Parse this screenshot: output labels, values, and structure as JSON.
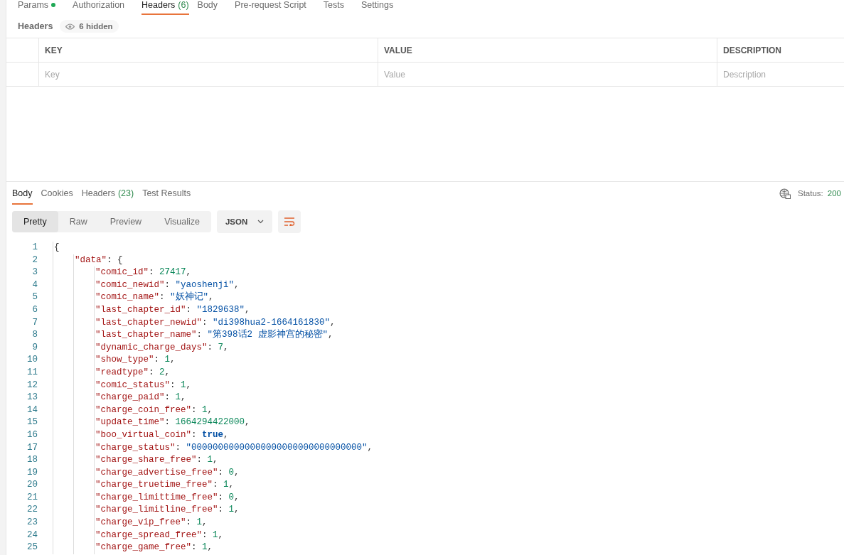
{
  "request_tabs": [
    {
      "label": "Params",
      "dot": true,
      "selected": false
    },
    {
      "label": "Authorization",
      "dot": false,
      "selected": false
    },
    {
      "label": "Headers",
      "count": "(6)",
      "dot": false,
      "selected": true
    },
    {
      "label": "Body",
      "dot": false,
      "selected": false
    },
    {
      "label": "Pre-request Script",
      "dot": false,
      "selected": false
    },
    {
      "label": "Tests",
      "dot": false,
      "selected": false
    },
    {
      "label": "Settings",
      "dot": false,
      "selected": false
    }
  ],
  "headers_bar": {
    "title": "Headers",
    "hidden": "6 hidden"
  },
  "table": {
    "columns": [
      "KEY",
      "VALUE",
      "DESCRIPTION"
    ],
    "placeholders": [
      "Key",
      "Value",
      "Description"
    ]
  },
  "response_tabs": [
    {
      "label": "Body",
      "selected": true
    },
    {
      "label": "Cookies",
      "selected": false
    },
    {
      "label": "Headers",
      "count": "(23)",
      "selected": false
    },
    {
      "label": "Test Results",
      "selected": false
    }
  ],
  "status": {
    "label": "Status:",
    "value": "200"
  },
  "view_modes": [
    {
      "label": "Pretty",
      "selected": true
    },
    {
      "label": "Raw",
      "selected": false
    },
    {
      "label": "Preview",
      "selected": false
    },
    {
      "label": "Visualize",
      "selected": false
    }
  ],
  "format": "JSON",
  "code": [
    {
      "number": "1",
      "tokens": [
        {
          "kind": "punct",
          "text": "{"
        }
      ],
      "children": [
        {
          "number": "2",
          "tokens": [
            {
              "kind": "key",
              "text": "\"data\""
            },
            {
              "kind": "punct",
              "text": ": {"
            }
          ],
          "children": [
            {
              "number": "3",
              "tokens": [
                {
                  "kind": "key",
                  "text": "\"comic_id\""
                },
                {
                  "kind": "punct",
                  "text": ": "
                },
                {
                  "kind": "number",
                  "text": "27417"
                },
                {
                  "kind": "punct",
                  "text": ","
                }
              ]
            },
            {
              "number": "4",
              "tokens": [
                {
                  "kind": "key",
                  "text": "\"comic_newid\""
                },
                {
                  "kind": "punct",
                  "text": ": "
                },
                {
                  "kind": "string",
                  "text": "\"yaoshenji\""
                },
                {
                  "kind": "punct",
                  "text": ","
                }
              ]
            },
            {
              "number": "5",
              "tokens": [
                {
                  "kind": "key",
                  "text": "\"comic_name\""
                },
                {
                  "kind": "punct",
                  "text": ": "
                },
                {
                  "kind": "string",
                  "text": "\"妖神记\""
                },
                {
                  "kind": "punct",
                  "text": ","
                }
              ]
            },
            {
              "number": "6",
              "tokens": [
                {
                  "kind": "key",
                  "text": "\"last_chapter_id\""
                },
                {
                  "kind": "punct",
                  "text": ": "
                },
                {
                  "kind": "string",
                  "text": "\"1829638\""
                },
                {
                  "kind": "punct",
                  "text": ","
                }
              ]
            },
            {
              "number": "7",
              "tokens": [
                {
                  "kind": "key",
                  "text": "\"last_chapter_newid\""
                },
                {
                  "kind": "punct",
                  "text": ": "
                },
                {
                  "kind": "string",
                  "text": "\"di398hua2-1664161830\""
                },
                {
                  "kind": "punct",
                  "text": ","
                }
              ]
            },
            {
              "number": "8",
              "tokens": [
                {
                  "kind": "key",
                  "text": "\"last_chapter_name\""
                },
                {
                  "kind": "punct",
                  "text": ": "
                },
                {
                  "kind": "string",
                  "text": "\"第398话2 虚影神宫的秘密\""
                },
                {
                  "kind": "punct",
                  "text": ","
                }
              ]
            },
            {
              "number": "9",
              "tokens": [
                {
                  "kind": "key",
                  "text": "\"dynamic_charge_days\""
                },
                {
                  "kind": "punct",
                  "text": ": "
                },
                {
                  "kind": "number",
                  "text": "7"
                },
                {
                  "kind": "punct",
                  "text": ","
                }
              ]
            },
            {
              "number": "10",
              "tokens": [
                {
                  "kind": "key",
                  "text": "\"show_type\""
                },
                {
                  "kind": "punct",
                  "text": ": "
                },
                {
                  "kind": "number",
                  "text": "1"
                },
                {
                  "kind": "punct",
                  "text": ","
                }
              ]
            },
            {
              "number": "11",
              "tokens": [
                {
                  "kind": "key",
                  "text": "\"readtype\""
                },
                {
                  "kind": "punct",
                  "text": ": "
                },
                {
                  "kind": "number",
                  "text": "2"
                },
                {
                  "kind": "punct",
                  "text": ","
                }
              ]
            },
            {
              "number": "12",
              "tokens": [
                {
                  "kind": "key",
                  "text": "\"comic_status\""
                },
                {
                  "kind": "punct",
                  "text": ": "
                },
                {
                  "kind": "number",
                  "text": "1"
                },
                {
                  "kind": "punct",
                  "text": ","
                }
              ]
            },
            {
              "number": "13",
              "tokens": [
                {
                  "kind": "key",
                  "text": "\"charge_paid\""
                },
                {
                  "kind": "punct",
                  "text": ": "
                },
                {
                  "kind": "number",
                  "text": "1"
                },
                {
                  "kind": "punct",
                  "text": ","
                }
              ]
            },
            {
              "number": "14",
              "tokens": [
                {
                  "kind": "key",
                  "text": "\"charge_coin_free\""
                },
                {
                  "kind": "punct",
                  "text": ": "
                },
                {
                  "kind": "number",
                  "text": "1"
                },
                {
                  "kind": "punct",
                  "text": ","
                }
              ]
            },
            {
              "number": "15",
              "tokens": [
                {
                  "kind": "key",
                  "text": "\"update_time\""
                },
                {
                  "kind": "punct",
                  "text": ": "
                },
                {
                  "kind": "number",
                  "text": "1664294422000"
                },
                {
                  "kind": "punct",
                  "text": ","
                }
              ]
            },
            {
              "number": "16",
              "tokens": [
                {
                  "kind": "key",
                  "text": "\"boo_virtual_coin\""
                },
                {
                  "kind": "punct",
                  "text": ": "
                },
                {
                  "kind": "boolean",
                  "text": "true"
                },
                {
                  "kind": "punct",
                  "text": ","
                }
              ]
            },
            {
              "number": "17",
              "tokens": [
                {
                  "kind": "key",
                  "text": "\"charge_status\""
                },
                {
                  "kind": "punct",
                  "text": ": "
                },
                {
                  "kind": "string",
                  "text": "\"00000000000000000000000000000000\""
                },
                {
                  "kind": "punct",
                  "text": ","
                }
              ]
            },
            {
              "number": "18",
              "tokens": [
                {
                  "kind": "key",
                  "text": "\"charge_share_free\""
                },
                {
                  "kind": "punct",
                  "text": ": "
                },
                {
                  "kind": "number",
                  "text": "1"
                },
                {
                  "kind": "punct",
                  "text": ","
                }
              ]
            },
            {
              "number": "19",
              "tokens": [
                {
                  "kind": "key",
                  "text": "\"charge_advertise_free\""
                },
                {
                  "kind": "punct",
                  "text": ": "
                },
                {
                  "kind": "number",
                  "text": "0"
                },
                {
                  "kind": "punct",
                  "text": ","
                }
              ]
            },
            {
              "number": "20",
              "tokens": [
                {
                  "kind": "key",
                  "text": "\"charge_truetime_free\""
                },
                {
                  "kind": "punct",
                  "text": ": "
                },
                {
                  "kind": "number",
                  "text": "1"
                },
                {
                  "kind": "punct",
                  "text": ","
                }
              ]
            },
            {
              "number": "21",
              "tokens": [
                {
                  "kind": "key",
                  "text": "\"charge_limittime_free\""
                },
                {
                  "kind": "punct",
                  "text": ": "
                },
                {
                  "kind": "number",
                  "text": "0"
                },
                {
                  "kind": "punct",
                  "text": ","
                }
              ]
            },
            {
              "number": "22",
              "tokens": [
                {
                  "kind": "key",
                  "text": "\"charge_limitline_free\""
                },
                {
                  "kind": "punct",
                  "text": ": "
                },
                {
                  "kind": "number",
                  "text": "1"
                },
                {
                  "kind": "punct",
                  "text": ","
                }
              ]
            },
            {
              "number": "23",
              "tokens": [
                {
                  "kind": "key",
                  "text": "\"charge_vip_free\""
                },
                {
                  "kind": "punct",
                  "text": ": "
                },
                {
                  "kind": "number",
                  "text": "1"
                },
                {
                  "kind": "punct",
                  "text": ","
                }
              ]
            },
            {
              "number": "24",
              "tokens": [
                {
                  "kind": "key",
                  "text": "\"charge_spread_free\""
                },
                {
                  "kind": "punct",
                  "text": ": "
                },
                {
                  "kind": "number",
                  "text": "1"
                },
                {
                  "kind": "punct",
                  "text": ","
                }
              ]
            },
            {
              "number": "25",
              "tokens": [
                {
                  "kind": "key",
                  "text": "\"charge_game_free\""
                },
                {
                  "kind": "punct",
                  "text": ": "
                },
                {
                  "kind": "number",
                  "text": "1"
                },
                {
                  "kind": "punct",
                  "text": ","
                }
              ]
            }
          ]
        }
      ]
    }
  ]
}
